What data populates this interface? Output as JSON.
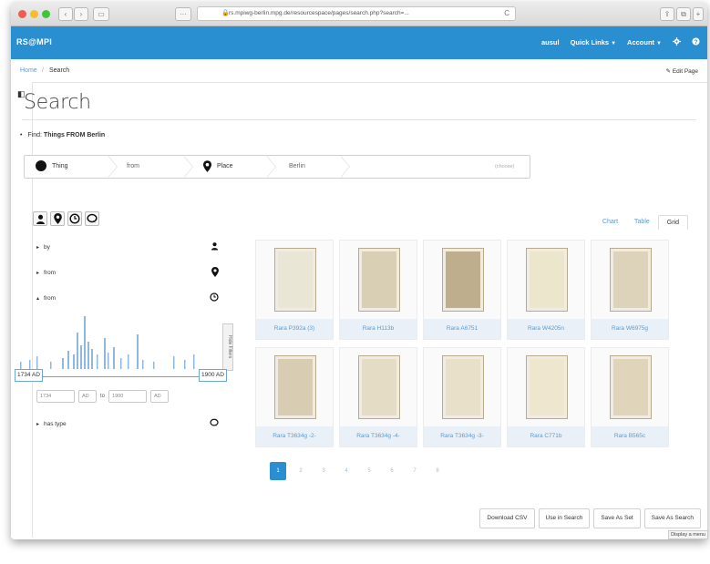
{
  "browser": {
    "url": "rs.mpiwg-berlin.mpg.de/resourcespace/pages/search.php?search=...",
    "back": "‹",
    "forward": "›",
    "sidebar": "▭",
    "reload": "C",
    "share": "⇪",
    "tabs": "⧉",
    "new_tab": "+"
  },
  "app": {
    "brand": "RS@MPI",
    "user": "ausul",
    "quick_links": "Quick Links",
    "account": "Account",
    "accent": "#2a8fd0"
  },
  "breadcrumb": {
    "home": "Home",
    "separator": "/",
    "current": "Search",
    "edit": "Edit Page"
  },
  "page": {
    "title": "Search"
  },
  "find": {
    "prefix": "Find:",
    "query": "Things FROM Berlin"
  },
  "querybar": {
    "segments": [
      "Thing",
      "from",
      "Place",
      "Berlin"
    ],
    "placeholder": "(choose)"
  },
  "filters": {
    "icons": [
      "person-icon",
      "location-pin-icon",
      "clock-icon",
      "chat-bubble-icon"
    ],
    "rows": [
      {
        "label": "by",
        "state": "collapsed",
        "icon": "person-icon"
      },
      {
        "label": "from",
        "state": "collapsed",
        "icon": "location-pin-icon"
      },
      {
        "label": "from",
        "state": "expanded",
        "icon": "clock-icon"
      },
      {
        "label": "has type",
        "state": "collapsed",
        "icon": "chat-bubble-icon"
      }
    ],
    "range_start": "1734 AD",
    "range_end": "1900 AD",
    "from_year": "1734",
    "from_era": "AD",
    "to_label": "to",
    "to_year": "1900",
    "to_era": "AD",
    "hide_filters": "Hide Filters"
  },
  "views": {
    "tabs": [
      "Chart",
      "Table",
      "Grid"
    ],
    "active": "Grid"
  },
  "results": [
    {
      "id": "Rara P392a (3)"
    },
    {
      "id": "Rara H113b"
    },
    {
      "id": "Rara A6751"
    },
    {
      "id": "Rara W4205n"
    },
    {
      "id": "Rara W6975g"
    },
    {
      "id": "Rara T3634g -2-"
    },
    {
      "id": "Rara T3634g -4-"
    },
    {
      "id": "Rara T3634g -3-"
    },
    {
      "id": "Rara C771b"
    },
    {
      "id": "Rara B565c"
    }
  ],
  "pagination": {
    "pages": [
      "1",
      "2",
      "3",
      "4",
      "5",
      "6",
      "7",
      "8"
    ],
    "current": "1"
  },
  "actions": {
    "download_csv": "Download CSV",
    "use_in_search": "Use in Search",
    "save_as_set": "Save As Set",
    "save_as_search": "Save As Search",
    "tooltip": "Display a menu"
  }
}
